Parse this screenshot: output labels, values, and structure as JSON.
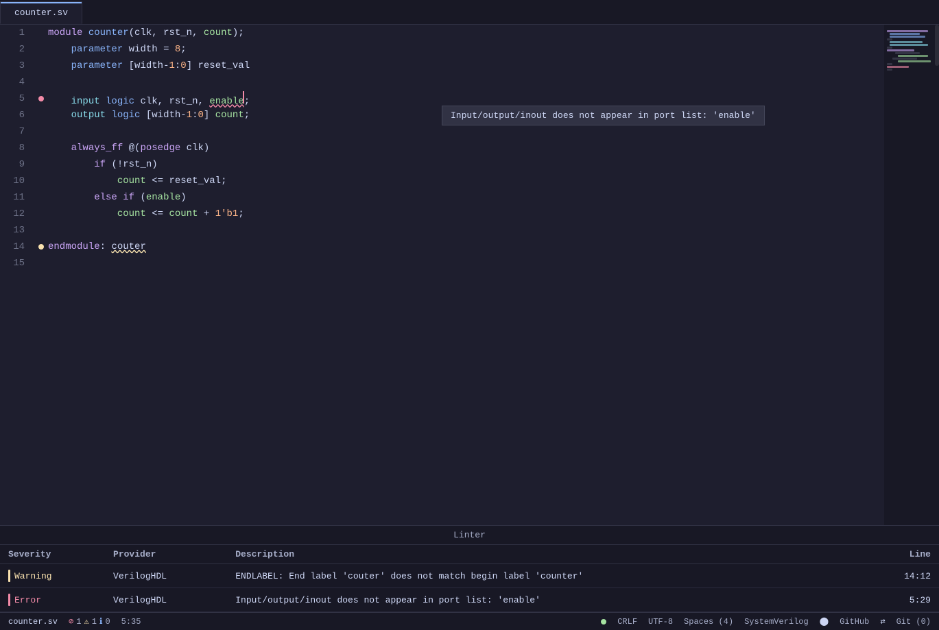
{
  "tabs": [
    {
      "label": "counter.sv",
      "active": true
    }
  ],
  "editor": {
    "tooltip": "Input/output/inout does not appear in port list: 'enable'",
    "lines": [
      {
        "num": 1,
        "dot": null,
        "code": "<span class='kw-module'>module</span> <span class='ident-fn'>counter</span><span class='punct'>(</span><span class='ident'>clk</span><span class='punct'>,</span> <span class='ident'>rst_n</span><span class='punct'>,</span> <span class='kw-count-ident'>count</span><span class='punct'>);</span>"
      },
      {
        "num": 2,
        "dot": null,
        "code": "    <span class='kw-param'>parameter</span> <span class='ident'>width</span> <span class='punct'>=</span> <span class='num'>8</span><span class='punct'>;</span>"
      },
      {
        "num": 3,
        "dot": null,
        "code": "    <span class='kw-param'>parameter</span> <span class='punct'>[</span><span class='ident'>width</span><span class='punct'>-</span><span class='num'>1</span><span class='punct'>:</span><span class='num'>0</span><span class='punct'>]</span> <span class='ident'>reset_val</span>"
      },
      {
        "num": 4,
        "dot": null,
        "code": ""
      },
      {
        "num": 5,
        "dot": "error",
        "code": "    <span class='kw-input'>input</span> <span class='kw-logic'>logic</span> <span class='ident'>clk</span><span class='punct'>,</span> <span class='ident'>rst_n</span><span class='punct'>,</span> <span class='squiggle-underline kw-enable'>enable</span><span class='punct'>;</span>"
      },
      {
        "num": 6,
        "dot": null,
        "code": "    <span class='kw-output'>output</span> <span class='kw-logic'>logic</span> <span class='punct'>[</span><span class='ident'>width</span><span class='punct'>-</span><span class='num'>1</span><span class='punct'>:</span><span class='num'>0</span><span class='punct'>]</span> <span class='kw-count-ident'>count</span><span class='punct'>;</span>"
      },
      {
        "num": 7,
        "dot": null,
        "code": ""
      },
      {
        "num": 8,
        "dot": null,
        "code": "    <span class='kw-always'>always_ff</span> <span class='punct'>@(</span><span class='kw-posedge'>posedge</span> <span class='ident'>clk</span><span class='punct'>)</span>"
      },
      {
        "num": 9,
        "dot": null,
        "code": "        <span class='kw-if'>if</span> <span class='punct'>(!</span><span class='ident'>rst_n</span><span class='punct'>)</span>"
      },
      {
        "num": 10,
        "dot": null,
        "code": "            <span class='kw-count-ident'>count</span> <span class='punct'>&lt;=</span> <span class='ident'>reset_val</span><span class='punct'>;</span>"
      },
      {
        "num": 11,
        "dot": null,
        "code": "        <span class='kw-else'>else</span> <span class='kw-if'>if</span> <span class='punct'>(</span><span class='kw-enable'>enable</span><span class='punct'>)</span>"
      },
      {
        "num": 12,
        "dot": null,
        "code": "            <span class='kw-count-ident'>count</span> <span class='punct'>&lt;=</span> <span class='kw-count-ident'>count</span> <span class='punct'>+</span> <span class='num'>1'b1</span><span class='punct'>;</span>"
      },
      {
        "num": 13,
        "dot": null,
        "code": ""
      },
      {
        "num": 14,
        "dot": "warning",
        "code": "<span class='kw-endmodule'>endmodule</span><span class='punct'>:</span> <span class='squiggle-yellow ident'>couter</span>"
      },
      {
        "num": 15,
        "dot": null,
        "code": ""
      }
    ]
  },
  "linter": {
    "title": "Linter",
    "columns": {
      "severity": "Severity",
      "provider": "Provider",
      "description": "Description",
      "line": "Line"
    },
    "rows": [
      {
        "severity": "Warning",
        "severity_type": "warning",
        "provider": "VerilogHDL",
        "description": "ENDLABEL: End label 'couter' does not match begin label 'counter'",
        "line": "14:12"
      },
      {
        "severity": "Error",
        "severity_type": "error",
        "provider": "VerilogHDL",
        "description": "Input/output/inout does not appear in port list: 'enable'",
        "line": "5:29"
      }
    ]
  },
  "statusbar": {
    "filename": "counter.sv",
    "error_count": "1",
    "warning_count": "1",
    "info_count": "0",
    "cursor_pos": "5:35",
    "line_ending": "CRLF",
    "encoding": "UTF-8",
    "indent": "Spaces (4)",
    "language": "SystemVerilog",
    "github_label": "GitHub",
    "git_label": "Git (0)"
  }
}
